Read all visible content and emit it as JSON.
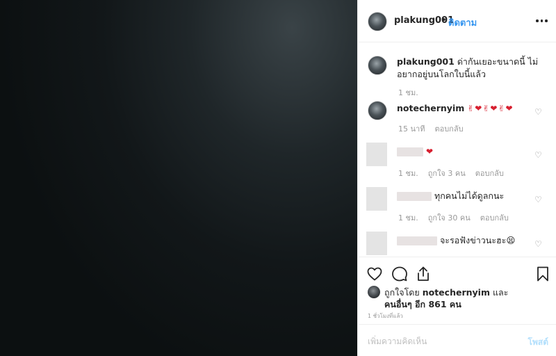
{
  "header": {
    "username": "plakung001",
    "separator": "•",
    "follow_label": "ติดตาม"
  },
  "caption": {
    "username": "plakung001",
    "text": "ด่ากันเยอะขนาดนี้ ไม่อยากอยู่บนโลกใบนี้แล้ว",
    "time": "1 ชม."
  },
  "comments": [
    {
      "username": "notechernyim",
      "text": "✌❤✌❤✌❤",
      "time": "15 นาที",
      "reply_label": "ตอบกลับ"
    },
    {
      "username": "",
      "text": "❤",
      "time": "1 ชม.",
      "likes": "ถูกใจ 3 คน",
      "reply_label": "ตอบกลับ"
    },
    {
      "username": "",
      "text": "ทุกคนไม่ได้ดูลกนะ",
      "time": "1 ชม.",
      "likes": "ถูกใจ 30 คน",
      "reply_label": "ตอบกลับ"
    },
    {
      "username": "",
      "text": "จะรอฟังข่าวนะฮะ😫"
    }
  ],
  "likes": {
    "prefix": "ถูกใจโดย",
    "user": "notechernyim",
    "middle": "และ",
    "others": "คนอื่นๆ อีก 861 คน"
  },
  "time_ago": "1 ชั่วโมงที่แล้ว",
  "comment_box": {
    "placeholder": "เพิ่มความคิดเห็น",
    "post_label": "โพสต์"
  },
  "colors": {
    "link": "#3897f0",
    "heart": "#d71f2f"
  },
  "icons": [
    "more-icon",
    "heart-icon",
    "comment-icon",
    "share-icon",
    "bookmark-icon"
  ]
}
